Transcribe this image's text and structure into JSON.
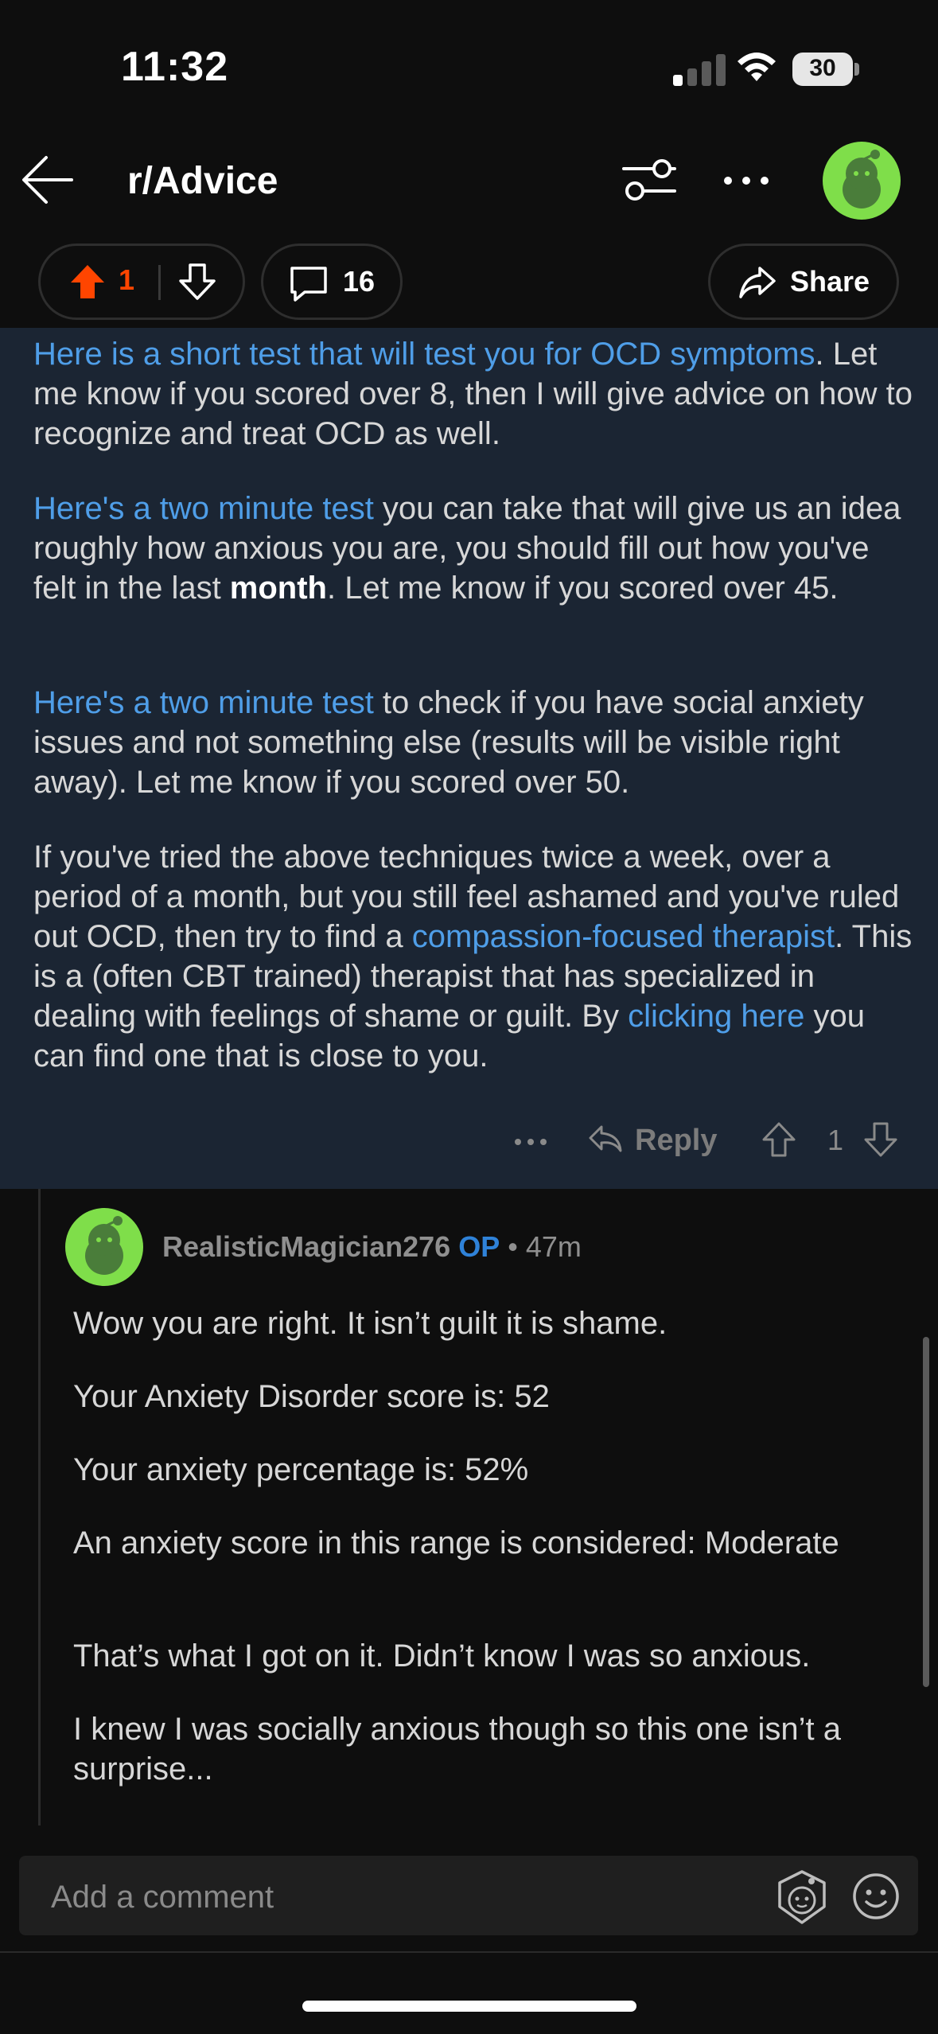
{
  "status_bar": {
    "time": "11:32",
    "battery": "30"
  },
  "header": {
    "title": "r/Advice"
  },
  "actions": {
    "upvotes": "1",
    "comments": "16",
    "share_label": "Share"
  },
  "parent_comment": {
    "p1": {
      "link": "Here is a short test that will test you for OCD symptoms",
      "text": ". Let me know if you scored over 8, then I will give advice on how to recognize and treat OCD as well."
    },
    "p2": {
      "link": "Here's a two minute test",
      "text_a": " you can take that will give us an idea roughly how anxious you are, you should fill out how you've felt in the last ",
      "bold": "month",
      "text_b": ". Let me know if you scored over 45."
    },
    "p3": {
      "link": "Here's a two minute test",
      "text": " to check if you have social anxiety issues and not something else (results will be visible right away). Let me know if you scored over 50."
    },
    "p4": {
      "text_a": "If you've tried the above techniques twice a week, over a period of a month, but you still feel ashamed and you've ruled out OCD, then try to find a ",
      "link_a": "compassion-focused therapist",
      "text_b": ". This is a (often CBT trained) therapist that has specialized in dealing with feelings of shame or guilt. By ",
      "link_b": "clicking here",
      "text_c": " you can find one that is close to you."
    },
    "reply_label": "Reply",
    "votes": "1"
  },
  "reply_comment": {
    "author": "RealisticMagician276",
    "op_badge": "OP",
    "separator": "•",
    "age": "47m",
    "lines": [
      "Wow you are right. It isn’t guilt it is shame.",
      "Your Anxiety Disorder score is: 52",
      "Your anxiety percentage is: 52%",
      "An anxiety score in this range is considered: Moderate",
      "That’s what I got on it. Didn’t know I was so anxious.",
      "I knew I was socially anxious though so this one isn’t a surprise..."
    ]
  },
  "comment_box": {
    "placeholder": "Add a comment"
  },
  "colors": {
    "accent_link": "#4f9ee8",
    "upvote": "#ff4500",
    "op": "#2f82d8",
    "avatar": "#7fde4a",
    "highlight_bg": "#1b2533"
  },
  "icons": [
    "back-arrow-icon",
    "filter-icon",
    "more-icon",
    "upvote-icon",
    "downvote-icon",
    "comment-icon",
    "share-icon",
    "reply-icon",
    "snoo-icon",
    "emoji-icon"
  ]
}
